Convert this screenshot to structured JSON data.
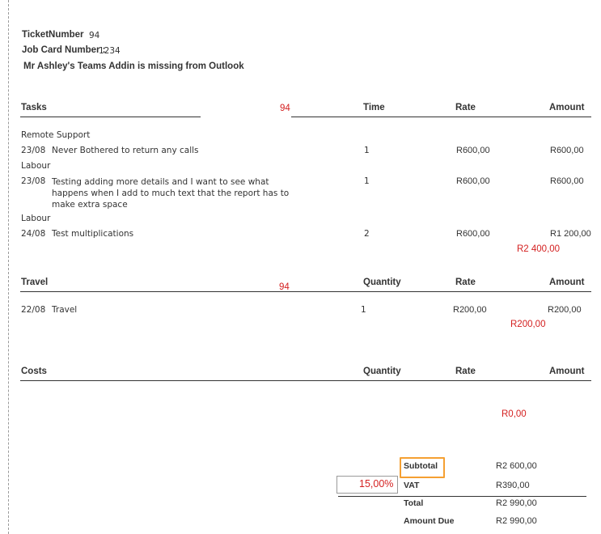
{
  "header": {
    "ticket_label": "TicketNumber",
    "ticket_value": "94",
    "job_card_label": "Job Card Number :",
    "job_card_value": "1234",
    "description": "Mr Ashley's Teams Addin is missing from Outlook"
  },
  "tasks": {
    "headers": {
      "name": "Tasks",
      "ref": "94",
      "time": "Time",
      "rate": "Rate",
      "amount": "Amount"
    },
    "groups": [
      {
        "category": "Remote Support",
        "date": "23/08",
        "description": "Never Bothered to return any calls",
        "time": "1",
        "rate": "R600,00",
        "amount": "R600,00"
      },
      {
        "category": "Labour",
        "date": "23/08",
        "description": "Testing adding more details and I want to see what happens when I add to much text that the report has to make extra space",
        "time": "1",
        "rate": "R600,00",
        "amount": "R600,00"
      },
      {
        "category": "Labour",
        "date": "24/08",
        "description": "Test multiplications",
        "time": "2",
        "rate": "R600,00",
        "amount": "R1 200,00"
      }
    ],
    "total": "R2 400,00"
  },
  "travel": {
    "headers": {
      "name": "Travel",
      "ref": "94",
      "quantity": "Quantity",
      "rate": "Rate",
      "amount": "Amount"
    },
    "rows": [
      {
        "date": "22/08",
        "description": "Travel",
        "quantity": "1",
        "rate": "R200,00",
        "amount": "R200,00"
      }
    ],
    "total": "R200,00"
  },
  "costs": {
    "headers": {
      "name": "Costs",
      "quantity": "Quantity",
      "rate": "Rate",
      "amount": "Amount"
    },
    "total": "R0,00"
  },
  "summary": {
    "subtotal_label": "Subtotal",
    "subtotal_value": "R2 600,00",
    "vat_percent": "15,00%",
    "vat_label": "VAT",
    "vat_value": "R390,00",
    "total_label": "Total",
    "total_value": "R2 990,00",
    "amount_due_label": "Amount Due",
    "amount_due_value": "R2 990,00"
  },
  "colors": {
    "accent_red": "#d42020",
    "highlight_orange": "#f5a032"
  }
}
